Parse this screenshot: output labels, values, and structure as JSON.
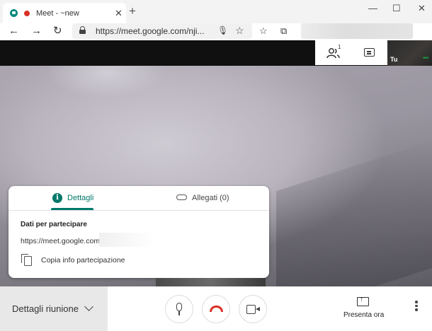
{
  "browser": {
    "tab_title": "Meet - ~new",
    "tab_close": "✕",
    "new_tab": "+",
    "window_controls": {
      "minimize": "—",
      "maximize": "☐",
      "close": "✕"
    },
    "nav": {
      "back": "←",
      "forward": "→",
      "refresh": "↻"
    },
    "url": "https://meet.google.com/nji...",
    "toolbar_icons": [
      "microphone-icon",
      "star-icon",
      "favorites-icon",
      "collections-icon"
    ]
  },
  "meet": {
    "people_count": "1",
    "self_label": "Tu",
    "self_more": "•••",
    "details_panel": {
      "tab_details": "Dettagli",
      "tab_attachments": "Allegati (0)",
      "join_heading": "Dati per partecipare",
      "join_url": "https://meet.google.com",
      "copy_label": "Copia info partecipazione"
    },
    "bottom_bar": {
      "meeting_details": "Dettagli riunione",
      "present_now": "Presenta ora"
    },
    "colors": {
      "accent": "#00796b",
      "hangup": "#d93025",
      "recording": "#d93025"
    }
  }
}
